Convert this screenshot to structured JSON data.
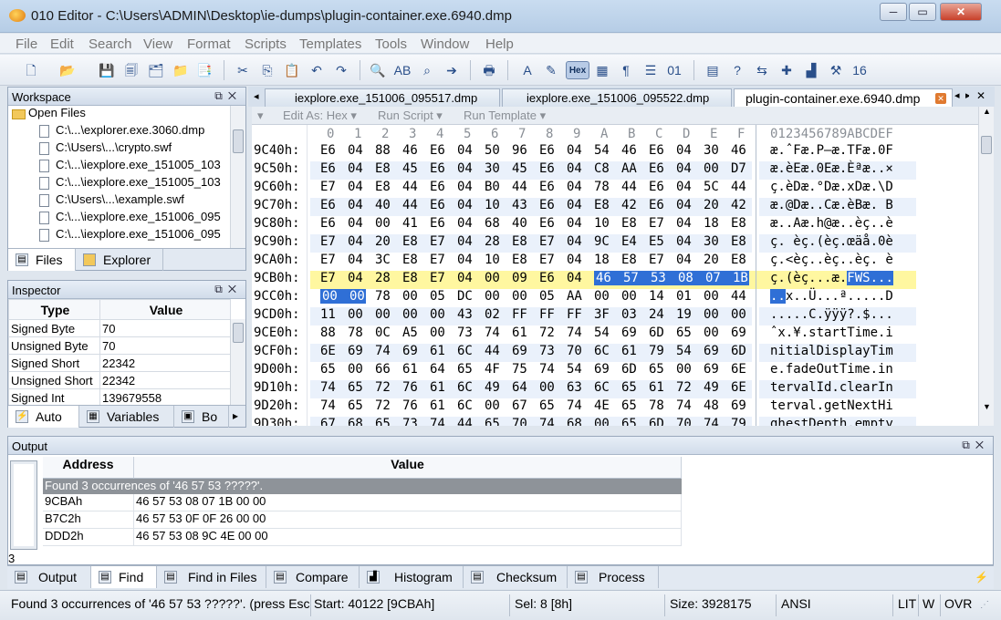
{
  "window": {
    "title": "010 Editor - C:\\Users\\ADMIN\\Desktop\\ie-dumps\\plugin-container.exe.6940.dmp",
    "minimize": "─",
    "maximize": "▭",
    "close": "✕"
  },
  "menu": [
    "File",
    "Edit",
    "Search",
    "View",
    "Format",
    "Scripts",
    "Templates",
    "Tools",
    "Window",
    "Help"
  ],
  "toolbar": {
    "hex_label": "Hex"
  },
  "workspace": {
    "title": "Workspace",
    "folder": "Open Files",
    "files": [
      "C:\\...\\explorer.exe.3060.dmp",
      "C:\\Users\\...\\crypto.swf",
      "C:\\...\\iexplore.exe_151005_103",
      "C:\\...\\iexplore.exe_151005_103",
      "C:\\Users\\...\\example.swf",
      "C:\\...\\iexplore.exe_151006_095",
      "C:\\...\\iexplore.exe_151006_095"
    ],
    "tabs": [
      "Files",
      "Explorer"
    ]
  },
  "inspector": {
    "title": "Inspector",
    "col_type": "Type",
    "col_value": "Value",
    "rows": [
      {
        "type": "Signed Byte",
        "value": "70"
      },
      {
        "type": "Unsigned Byte",
        "value": "70"
      },
      {
        "type": "Signed Short",
        "value": "22342"
      },
      {
        "type": "Unsigned Short",
        "value": "22342"
      },
      {
        "type": "Signed Int",
        "value": "139679558"
      }
    ],
    "tabs": [
      "Auto",
      "Variables",
      "Bo"
    ]
  },
  "doc_tabs": [
    "iexplore.exe_151006_095517.dmp",
    "iexplore.exe_151006_095522.dmp",
    "plugin-container.exe.6940.dmp"
  ],
  "editor_bar": [
    "Edit As: Hex ▾",
    "Run Script ▾",
    "Run Template ▾"
  ],
  "hex": {
    "col_headers": [
      "0",
      "1",
      "2",
      "3",
      "4",
      "5",
      "6",
      "7",
      "8",
      "9",
      "A",
      "B",
      "C",
      "D",
      "E",
      "F"
    ],
    "ascii_header": "0123456789ABCDEF",
    "rows": [
      {
        "addr": "9C40h:",
        "bytes": [
          "E6",
          "04",
          "88",
          "46",
          "E6",
          "04",
          "50",
          "96",
          "E6",
          "04",
          "54",
          "46",
          "E6",
          "04",
          "30",
          "46"
        ],
        "ascii": "æ.ˆFæ.P–æ.TFæ.0F"
      },
      {
        "addr": "9C50h:",
        "bytes": [
          "E6",
          "04",
          "E8",
          "45",
          "E6",
          "04",
          "30",
          "45",
          "E6",
          "04",
          "C8",
          "AA",
          "E6",
          "04",
          "00",
          "D7"
        ],
        "ascii": "æ.èEæ.0Eæ.Èªæ..×"
      },
      {
        "addr": "9C60h:",
        "bytes": [
          "E7",
          "04",
          "E8",
          "44",
          "E6",
          "04",
          "B0",
          "44",
          "E6",
          "04",
          "78",
          "44",
          "E6",
          "04",
          "5C",
          "44"
        ],
        "ascii": "ç.èDæ.°Dæ.xDæ.\\D"
      },
      {
        "addr": "9C70h:",
        "bytes": [
          "E6",
          "04",
          "40",
          "44",
          "E6",
          "04",
          "10",
          "43",
          "E6",
          "04",
          "E8",
          "42",
          "E6",
          "04",
          "20",
          "42"
        ],
        "ascii": "æ.@Dæ..Cæ.èBæ. B"
      },
      {
        "addr": "9C80h:",
        "bytes": [
          "E6",
          "04",
          "00",
          "41",
          "E6",
          "04",
          "68",
          "40",
          "E6",
          "04",
          "10",
          "E8",
          "E7",
          "04",
          "18",
          "E8"
        ],
        "ascii": "æ..Aæ.h@æ..èç..è"
      },
      {
        "addr": "9C90h:",
        "bytes": [
          "E7",
          "04",
          "20",
          "E8",
          "E7",
          "04",
          "28",
          "E8",
          "E7",
          "04",
          "9C",
          "E4",
          "E5",
          "04",
          "30",
          "E8"
        ],
        "ascii": "ç. èç.(èç.œäå.0è"
      },
      {
        "addr": "9CA0h:",
        "bytes": [
          "E7",
          "04",
          "3C",
          "E8",
          "E7",
          "04",
          "10",
          "E8",
          "E7",
          "04",
          "18",
          "E8",
          "E7",
          "04",
          "20",
          "E8"
        ],
        "ascii": "ç.<èç..èç..èç. è"
      },
      {
        "addr": "9CB0h:",
        "bytes": [
          "E7",
          "04",
          "28",
          "E8",
          "E7",
          "04",
          "00",
          "09",
          "E6",
          "04",
          "46",
          "57",
          "53",
          "08",
          "07",
          "1B"
        ],
        "ascii": "ç.(èç...æ.FWS..."
      },
      {
        "addr": "9CC0h:",
        "bytes": [
          "00",
          "00",
          "78",
          "00",
          "05",
          "DC",
          "00",
          "00",
          "05",
          "AA",
          "00",
          "00",
          "14",
          "01",
          "00",
          "44"
        ],
        "ascii": "..x..Ü...ª.....D"
      },
      {
        "addr": "9CD0h:",
        "bytes": [
          "11",
          "00",
          "00",
          "00",
          "00",
          "43",
          "02",
          "FF",
          "FF",
          "FF",
          "3F",
          "03",
          "24",
          "19",
          "00",
          "00"
        ],
        "ascii": ".....C.ÿÿÿ?.$..."
      },
      {
        "addr": "9CE0h:",
        "bytes": [
          "88",
          "78",
          "0C",
          "A5",
          "00",
          "73",
          "74",
          "61",
          "72",
          "74",
          "54",
          "69",
          "6D",
          "65",
          "00",
          "69"
        ],
        "ascii": "ˆx.¥.startTime.i"
      },
      {
        "addr": "9CF0h:",
        "bytes": [
          "6E",
          "69",
          "74",
          "69",
          "61",
          "6C",
          "44",
          "69",
          "73",
          "70",
          "6C",
          "61",
          "79",
          "54",
          "69",
          "6D"
        ],
        "ascii": "nitialDisplayTim"
      },
      {
        "addr": "9D00h:",
        "bytes": [
          "65",
          "00",
          "66",
          "61",
          "64",
          "65",
          "4F",
          "75",
          "74",
          "54",
          "69",
          "6D",
          "65",
          "00",
          "69",
          "6E"
        ],
        "ascii": "e.fadeOutTime.in"
      },
      {
        "addr": "9D10h:",
        "bytes": [
          "74",
          "65",
          "72",
          "76",
          "61",
          "6C",
          "49",
          "64",
          "00",
          "63",
          "6C",
          "65",
          "61",
          "72",
          "49",
          "6E"
        ],
        "ascii": "tervalId.clearIn"
      },
      {
        "addr": "9D20h:",
        "bytes": [
          "74",
          "65",
          "72",
          "76",
          "61",
          "6C",
          "00",
          "67",
          "65",
          "74",
          "4E",
          "65",
          "78",
          "74",
          "48",
          "69"
        ],
        "ascii": "terval.getNextHi"
      },
      {
        "addr": "9D30h:",
        "bytes": [
          "67",
          "68",
          "65",
          "73",
          "74",
          "44",
          "65",
          "70",
          "74",
          "68",
          "00",
          "65",
          "6D",
          "70",
          "74",
          "79"
        ],
        "ascii": "ghestDepth.empty"
      }
    ]
  },
  "output": {
    "title": "Output",
    "col_address": "Address",
    "col_value": "Value",
    "summary": "Found 3 occurrences of '46 57 53 ?????'.",
    "count": "3",
    "results": [
      {
        "address": "9CBAh",
        "value": "46 57 53 08 07 1B 00 00"
      },
      {
        "address": "B7C2h",
        "value": "46 57 53 0F 0F 26 00 00"
      },
      {
        "address": "DDD2h",
        "value": "46 57 53 08 9C 4E 00 00"
      }
    ],
    "tabs": [
      "Output",
      "Find",
      "Find in Files",
      "Compare",
      "Histogram",
      "Checksum",
      "Process"
    ]
  },
  "status": {
    "message": "Found 3 occurrences of '46 57 53 ?????'. (press Esc",
    "start": "Start: 40122 [9CBAh]",
    "sel": "Sel: 8 [8h]",
    "size": "Size: 3928175",
    "encoding": "ANSI",
    "lit": "LIT",
    "w": "W",
    "ovr": "OVR"
  }
}
